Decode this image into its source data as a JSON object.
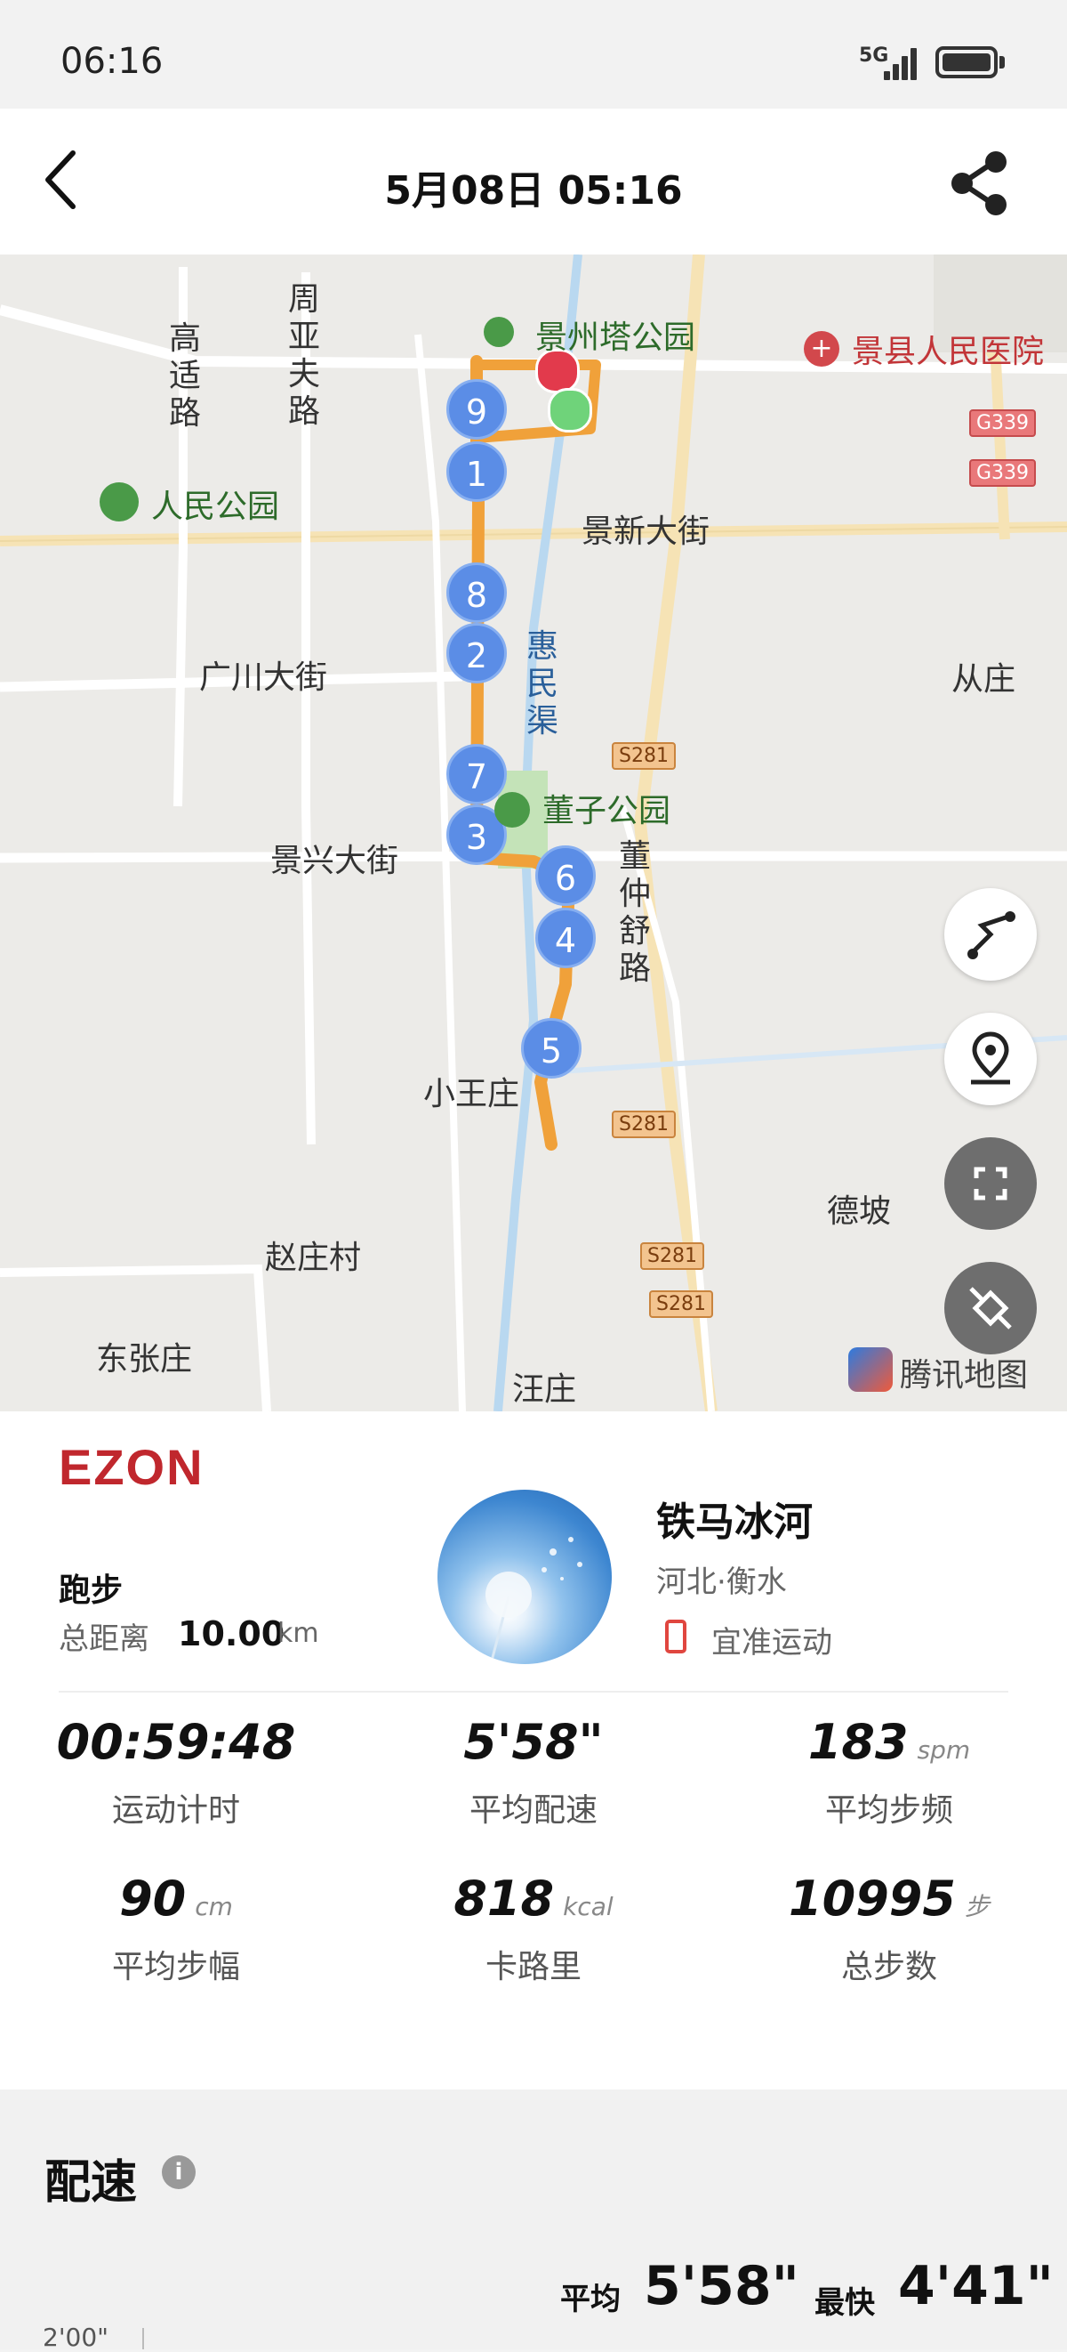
{
  "status_bar": {
    "time": "06:16",
    "network": "5G"
  },
  "header": {
    "title": "5月08日  05:16",
    "back_icon": "chevron-left-icon",
    "share_icon": "share-icon"
  },
  "map": {
    "labels": {
      "gaoshi_road": "高适路",
      "zhouyafu_road": "周亚夫路",
      "jingzhouta_park": "景州塔公园",
      "hospital": "景县人民医院",
      "renmin_park": "人民公园",
      "jingxin_street": "景新大街",
      "guangchuan_street": "广川大街",
      "huimin_canal": "惠民渠",
      "congzhuang": "从庄",
      "dongzi_park": "董子公园",
      "jingxing_street": "景兴大街",
      "dongzhongshu_road": "董仲舒路",
      "xiaowangzhuang": "小王庄",
      "dezhuang": "德坡",
      "zhaozhuang": "赵庄村",
      "dongzhangzhuang": "东张庄",
      "wangzhuang": "汪庄",
      "provider": "腾讯地图"
    },
    "shields": {
      "g339": "G339",
      "s281": "S281"
    },
    "km_markers": [
      "1",
      "2",
      "3",
      "4",
      "5",
      "6",
      "7",
      "8",
      "9"
    ],
    "route_color": "#f0a13a",
    "start_color": "#6fd37a",
    "end_color": "#e23a4c",
    "controls": [
      "route-replay-icon",
      "location-pin-icon",
      "fullscreen-icon",
      "satellite-icon"
    ]
  },
  "card": {
    "brand": "EZON",
    "sport": "跑步",
    "distance_label": "总距离",
    "distance_value": "10.00",
    "distance_unit": "km",
    "user_name": "铁马冰河",
    "user_location": "河北·衡水",
    "device": "宜准运动",
    "stats": [
      {
        "value": "00:59:48",
        "unit": "",
        "label": "运动计时"
      },
      {
        "value": "5'58\"",
        "unit": "",
        "label": "平均配速"
      },
      {
        "value": "183",
        "unit": "spm",
        "label": "平均步频"
      },
      {
        "value": "90",
        "unit": "cm",
        "label": "平均步幅"
      },
      {
        "value": "818",
        "unit": "kcal",
        "label": "卡路里"
      },
      {
        "value": "10995",
        "unit": "步",
        "label": "总步数"
      }
    ]
  },
  "pace": {
    "title": "配速",
    "avg_label": "平均",
    "avg_value": "5'58\"",
    "best_label": "最快",
    "best_value": "4'41\"",
    "y_tick": "2'00\""
  }
}
